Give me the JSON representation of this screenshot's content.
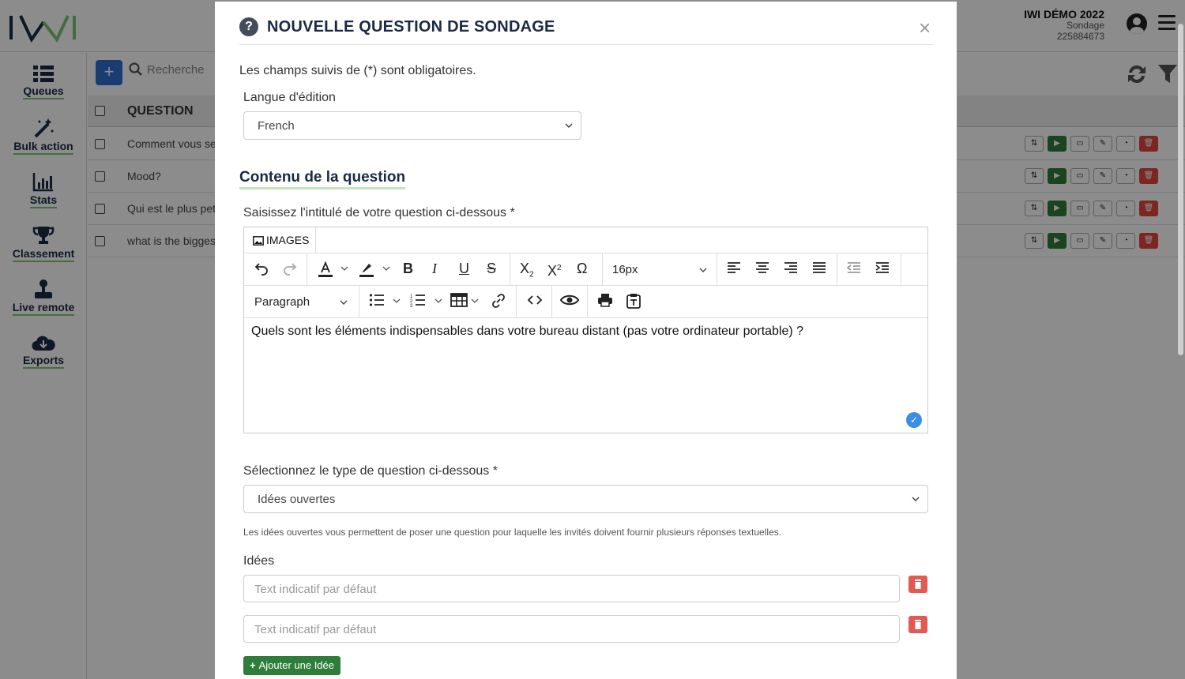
{
  "header": {
    "account_name": "IWI DÉMO 2022",
    "module": "Sondage",
    "account_id": "225884673"
  },
  "sidebar": {
    "items": [
      {
        "label": "Queues",
        "icon": "list-icon"
      },
      {
        "label": "Bulk action",
        "icon": "magic-wand-icon"
      },
      {
        "label": "Stats",
        "icon": "bar-chart-icon"
      },
      {
        "label": "Classement",
        "icon": "trophy-icon"
      },
      {
        "label": "Live remote",
        "icon": "joystick-icon"
      },
      {
        "label": "Exports",
        "icon": "cloud-download-icon"
      }
    ]
  },
  "toolbar": {
    "add_label": "+",
    "search_placeholder": "Recherche"
  },
  "table": {
    "header": "QUESTION",
    "rows": [
      {
        "question": "Comment vous se"
      },
      {
        "question": "Mood?"
      },
      {
        "question": "Qui est le plus pet"
      },
      {
        "question": "what is the bigges"
      }
    ]
  },
  "modal": {
    "title": "NOUVELLE QUESTION DE SONDAGE",
    "close": "×",
    "required_note": "Les champs suivis de (*) sont obligatoires.",
    "language_label": "Langue d'édition",
    "language_value": "French",
    "section_title": "Contenu de la question",
    "question_label": "Saisissez l'intitulé de votre question ci-dessous *",
    "editor": {
      "tab_images": "IMAGES",
      "font_size": "16px",
      "block_format": "Paragraph",
      "content": "Quels sont les éléments indispensables dans votre bureau distant (pas votre ordinateur portable) ?"
    },
    "type_label": "Sélectionnez le type de question ci-dessous *",
    "type_value": "Idées ouvertes",
    "type_help": "Les idées ouvertes vous permettent de poser une question pour laquelle les invités doivent fournir plusieurs réponses textuelles.",
    "ideas_label": "Idées",
    "idea_placeholder": "Text indicatif par défaut",
    "add_idea_label": "Ajouter une Idée"
  },
  "colors": {
    "navy": "#1a2a44",
    "accent_green": "#2f7d3a",
    "underline_green": "#7cc576",
    "danger": "#e25b53",
    "primary_blue": "#2f6fd1"
  }
}
